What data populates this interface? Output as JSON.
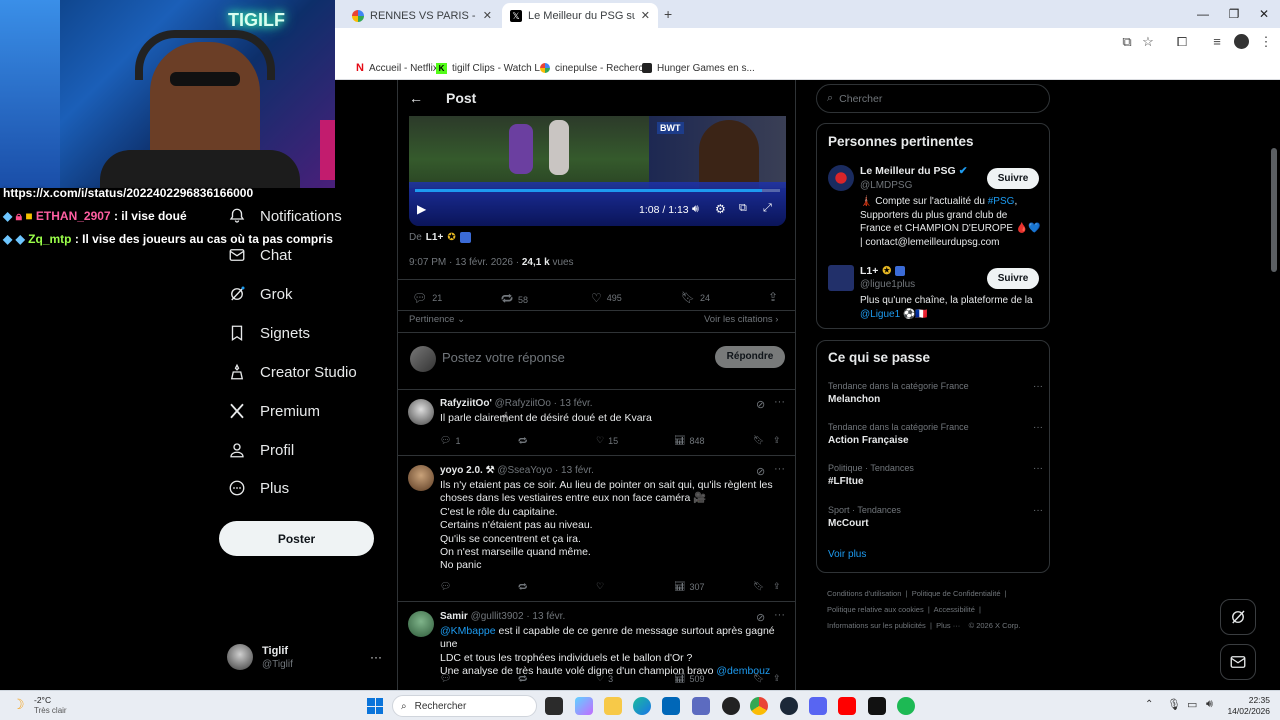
{
  "browser": {
    "tabs": [
      {
        "title": "RENNES VS PARIS - Recherche"
      },
      {
        "title": "Le Meilleur du PSG sur X : \""
      }
    ],
    "bookmarks": [
      "Accueil - Netflix",
      "tigilf Clips - Watch L...",
      "cinepulse - Recherc...",
      "Hunger Games en s..."
    ]
  },
  "stream": {
    "neon_sign": "TIGILF",
    "url_line": "https://x.com/i/status/2022402296836166000",
    "chat": [
      {
        "user": "ETHAN_2907",
        "message": ": il vise doué",
        "color": "#ff5fa2"
      },
      {
        "user": "Zq_mtp",
        "message": ": Il vise des joueurs au cas où ta pas compris",
        "color": "#9bff4a"
      }
    ]
  },
  "nav": {
    "items": [
      "Notifications",
      "Chat",
      "Grok",
      "Signets",
      "Creator Studio",
      "Premium",
      "Profil",
      "Plus"
    ],
    "post_button": "Poster",
    "account_name": "Tiglif",
    "account_handle": "@Tiglif",
    "more": "···"
  },
  "post": {
    "header": "Post",
    "video_time": "1:08 / 1:13",
    "video_progress": 0.95,
    "video_sign": "BWT",
    "from_label": "De",
    "from_source": "L1+",
    "timestamp": "9:07 PM · 13 févr. 2026 · ",
    "views_count": "24,1 k",
    "views_label": "vues",
    "stats": {
      "replies": "21",
      "reposts": "58",
      "likes": "495",
      "bookmarks": "24"
    },
    "sort_label": "Pertinence",
    "quotes_link": "Voir les citations",
    "reply_placeholder": "Postez votre réponse",
    "reply_button": "Répondre"
  },
  "replies": [
    {
      "name": "RafyziitOo'",
      "handle": "@RafyziitOo",
      "date": "· 13 févr.",
      "lines": [
        "Il parle clairement de désiré doué et de Kvara"
      ],
      "replies": "1",
      "reposts": "",
      "likes": "15",
      "views": "848"
    },
    {
      "name": "yoyo 2.0. ⚒",
      "handle": "@SseaYoyo",
      "date": "· 13 févr.",
      "lines": [
        "Ils n'y etaient pas ce soir. Au lieu de pointer on sait qui, qu'ils règlent les",
        "choses dans les vestiaires entre eux non face caméra 🎥",
        "C'est le rôle du capitaine.",
        "Certains n'étaient pas au niveau.",
        "Qu'ils se concentrent et ça ira.",
        "On n'est marseille quand même.",
        "No panic"
      ],
      "replies": "",
      "reposts": "",
      "likes": "",
      "views": "307"
    },
    {
      "name": "Samir",
      "handle": "@gullit3902",
      "date": "· 13 févr.",
      "lines": [
        "@KMbappe est il capable de ce genre de message surtout après gagné une",
        "LDC et tous les trophées individuels et le ballon d'Or ?",
        "Une analyse de très haute volé digne d'un champion bravo @dembouz"
      ],
      "replies": "",
      "reposts": "",
      "likes": "3",
      "views": "509"
    }
  ],
  "sidebar": {
    "search_placeholder": "Chercher",
    "relevant_title": "Personnes pertinentes",
    "people": [
      {
        "name": "Le Meilleur du PSG",
        "handle": "@LMDPSG",
        "bio": [
          "🗼 Compte sur l'actualité du #PSG,",
          "Supporters du plus grand club de",
          "France et CHAMPION D'EUROPE 🩸💙",
          "| contact@lemeilleurdupsg.com"
        ],
        "button": "Suivre"
      },
      {
        "name": "L1+",
        "handle": "@ligue1plus",
        "bio": [
          "Plus qu'une chaîne, la plateforme de la",
          "@Ligue1 ⚽🇫🇷"
        ],
        "button": "Suivre"
      }
    ],
    "trends_title": "Ce qui se passe",
    "trends": [
      {
        "context": "Tendance dans la catégorie France",
        "name": "Melanchon"
      },
      {
        "context": "Tendance dans la catégorie France",
        "name": "Action Française"
      },
      {
        "context": "Politique · Tendances",
        "name": "#LFItue"
      },
      {
        "context": "Sport · Tendances",
        "name": "McCourt"
      }
    ],
    "show_more": "Voir plus",
    "footer": [
      "Conditions d'utilisation",
      "Politique de Confidentialité",
      "Politique relative aux cookies",
      "Accessibilité",
      "Informations sur les publicités",
      "Plus ···",
      "© 2026 X Corp."
    ]
  },
  "taskbar": {
    "weather_temp": "-2°C",
    "weather_desc": "Très clair",
    "search_placeholder": "Rechercher",
    "time": "22:35",
    "date": "14/02/2026"
  }
}
